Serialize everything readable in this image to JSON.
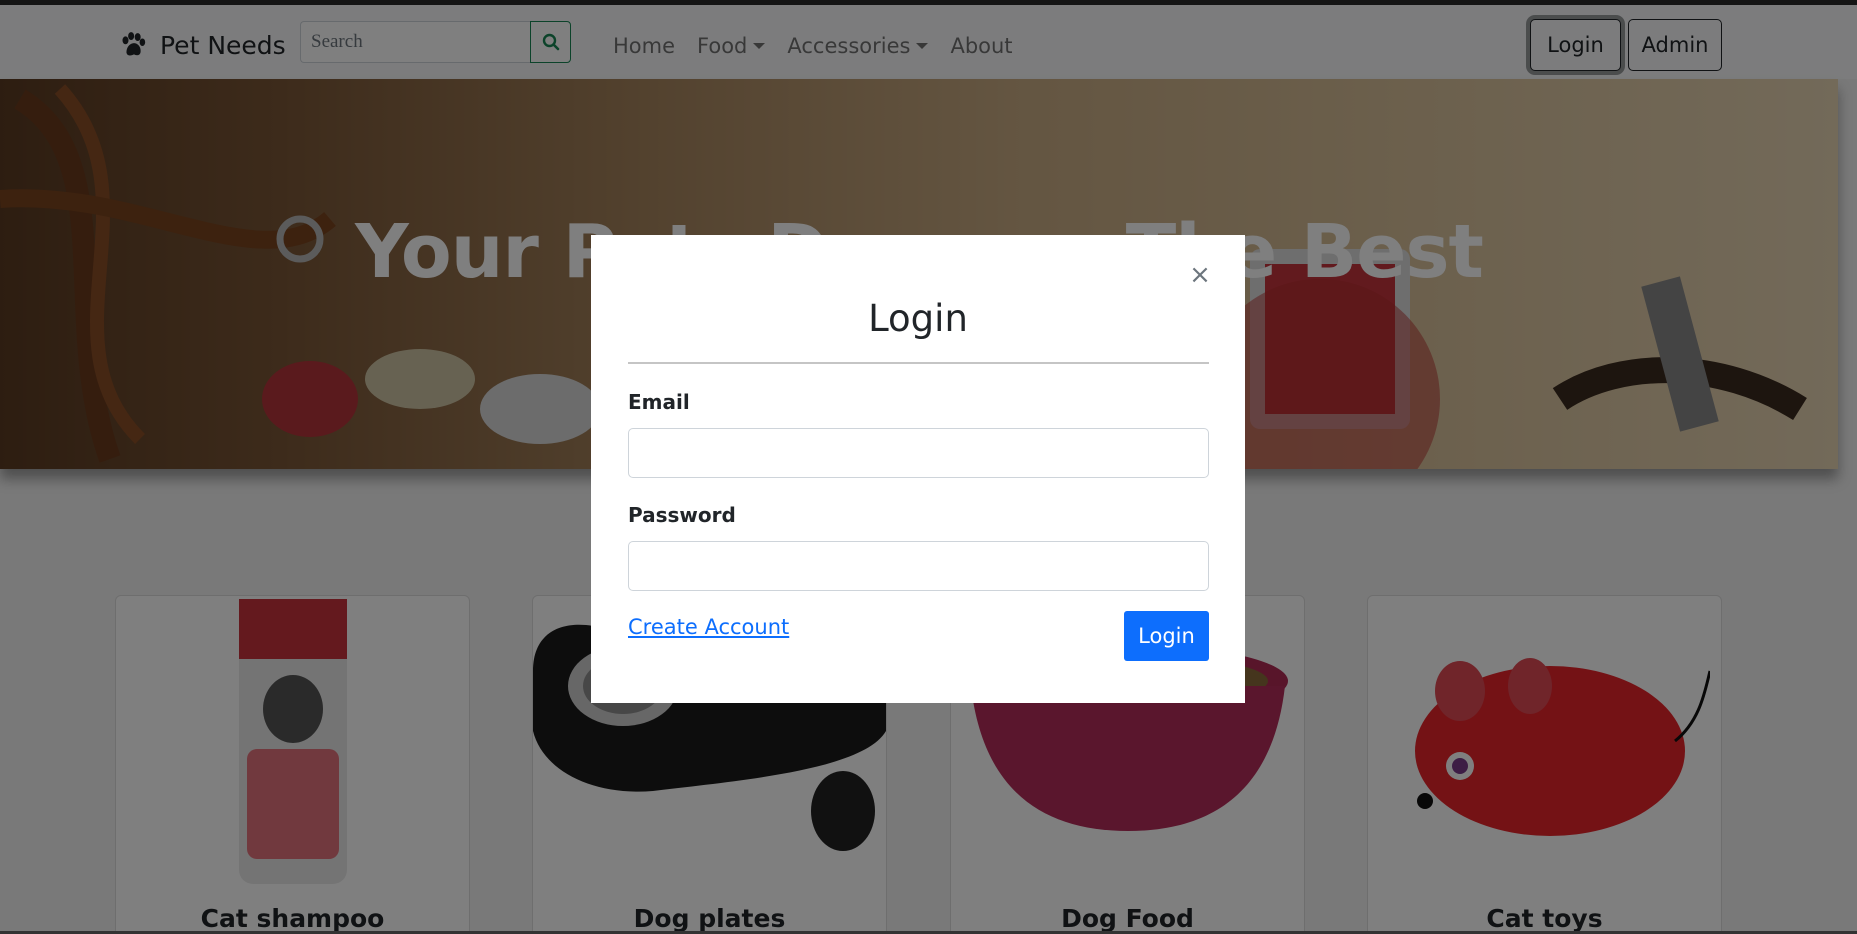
{
  "navbar": {
    "brand": "Pet Needs",
    "search_placeholder": "Search",
    "links": [
      {
        "label": "Home"
      },
      {
        "label": "Food"
      },
      {
        "label": "Accessories"
      },
      {
        "label": "About"
      }
    ],
    "login_label": "Login",
    "admin_label": "Admin"
  },
  "hero": {
    "title": "Your Pets Deserve The Best"
  },
  "products": [
    {
      "title": "Cat shampoo"
    },
    {
      "title": "Dog plates"
    },
    {
      "title": "Dog Food"
    },
    {
      "title": "Cat toys"
    }
  ],
  "modal": {
    "title": "Login",
    "close_glyph": "×",
    "email_label": "Email",
    "email_value": "",
    "password_label": "Password",
    "password_value": "",
    "create_account_label": "Create Account",
    "submit_label": "Login"
  },
  "colors": {
    "primary": "#0d6efd",
    "search_accent": "#198754",
    "backdrop": "rgba(0,0,0,0.5)"
  }
}
